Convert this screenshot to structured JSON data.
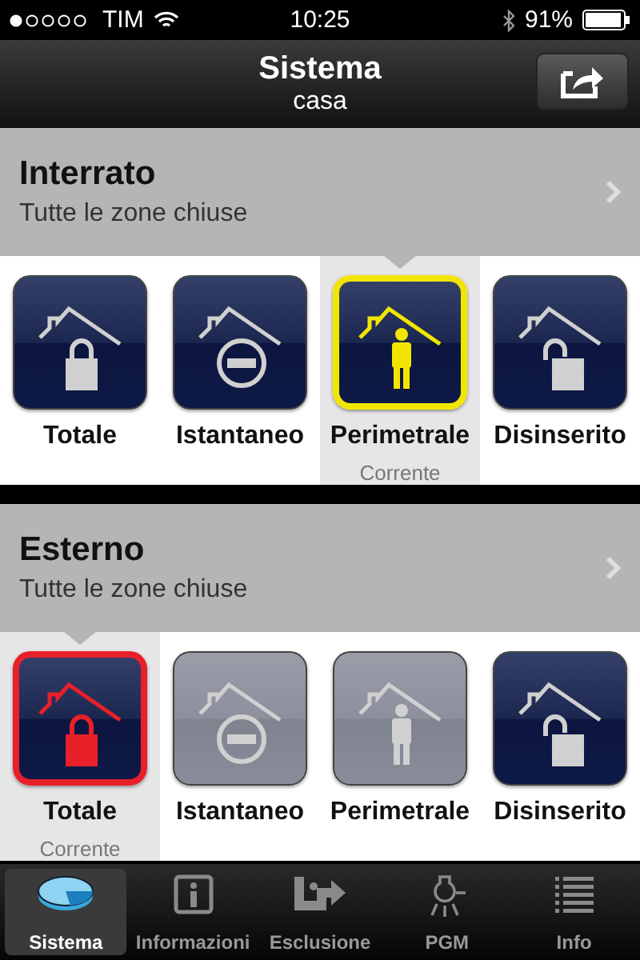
{
  "status_bar": {
    "carrier": "TIM",
    "time": "10:25",
    "battery": "91%"
  },
  "nav": {
    "title": "Sistema",
    "subtitle": "casa"
  },
  "sections": [
    {
      "title": "Interrato",
      "subtitle": "Tutte le zone chiuse",
      "modes": [
        {
          "label": "Totale",
          "kind": "lock",
          "selected": false,
          "disabled": false
        },
        {
          "label": "Istantaneo",
          "kind": "minus",
          "selected": false,
          "disabled": false
        },
        {
          "label": "Perimetrale",
          "kind": "person",
          "selected": true,
          "disabled": false,
          "color": "#f2e600",
          "note": "Corrente"
        },
        {
          "label": "Disinserito",
          "kind": "unlock",
          "selected": false,
          "disabled": false
        }
      ]
    },
    {
      "title": "Esterno",
      "subtitle": "Tutte le zone chiuse",
      "modes": [
        {
          "label": "Totale",
          "kind": "lock",
          "selected": true,
          "disabled": false,
          "color": "#e8202a",
          "note": "Corrente"
        },
        {
          "label": "Istantaneo",
          "kind": "minus",
          "selected": false,
          "disabled": true
        },
        {
          "label": "Perimetrale",
          "kind": "person",
          "selected": false,
          "disabled": true
        },
        {
          "label": "Disinserito",
          "kind": "unlock",
          "selected": false,
          "disabled": false
        }
      ]
    }
  ],
  "tabs": [
    {
      "label": "Sistema",
      "kind": "pie",
      "selected": true
    },
    {
      "label": "Informazioni",
      "kind": "info",
      "selected": false
    },
    {
      "label": "Esclusione",
      "kind": "bypass",
      "selected": false
    },
    {
      "label": "PGM",
      "kind": "bulb",
      "selected": false
    },
    {
      "label": "Info",
      "kind": "list",
      "selected": false
    }
  ]
}
